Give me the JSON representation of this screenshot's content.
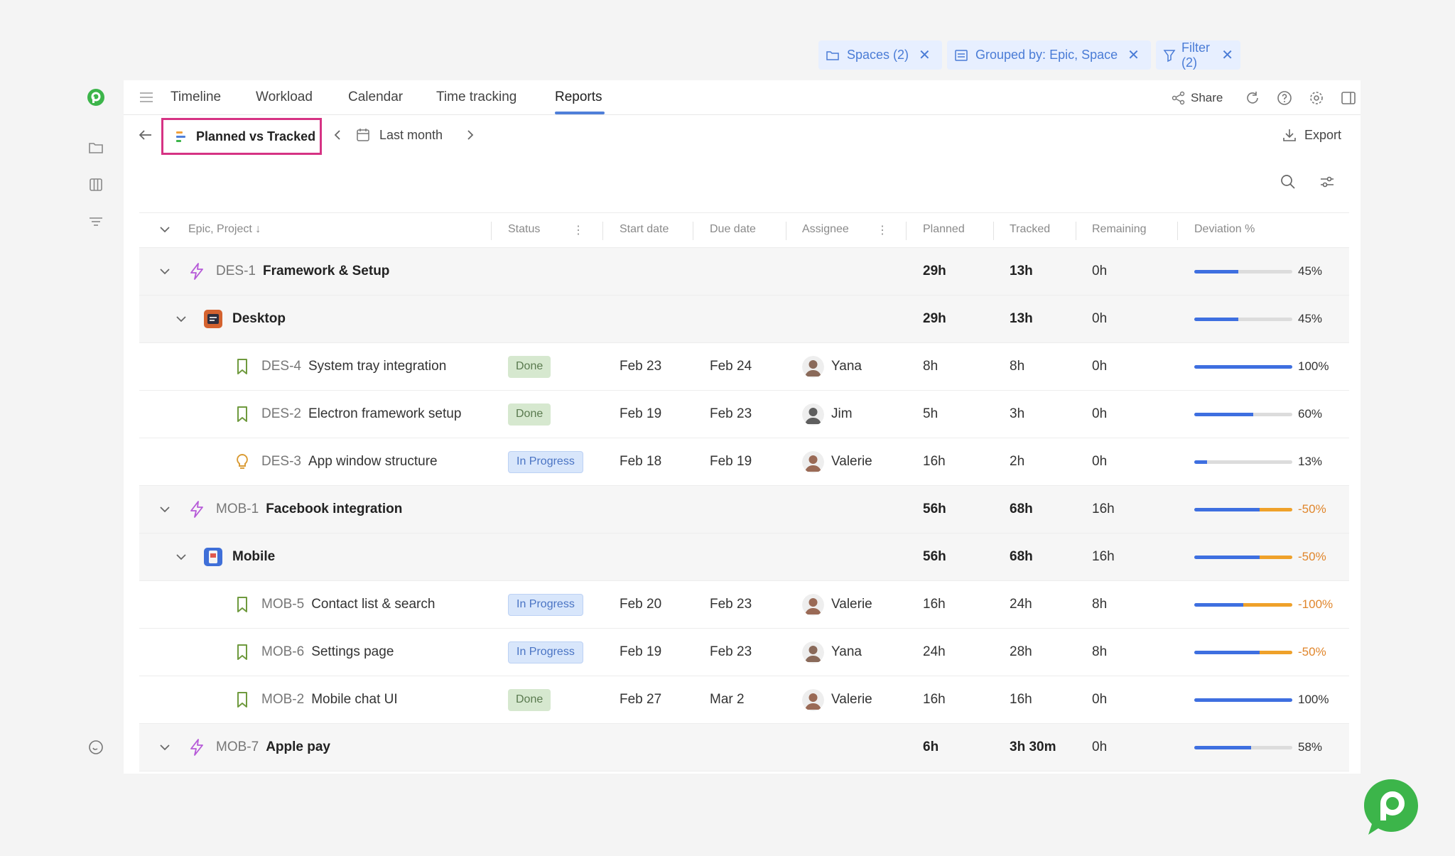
{
  "nav": {
    "tabs": [
      {
        "label": "Timeline"
      },
      {
        "label": "Workload"
      },
      {
        "label": "Calendar"
      },
      {
        "label": "Time tracking"
      },
      {
        "label": "Reports"
      }
    ],
    "active_tab": "Reports",
    "share_label": "Share"
  },
  "toolbar": {
    "report_name": "Planned vs Tracked",
    "period": "Last month",
    "chips": [
      {
        "label": "Spaces (2)",
        "icon": "folder-icon"
      },
      {
        "label": "Grouped by: Epic, Space",
        "icon": "group-icon"
      },
      {
        "label": "Filter (2)",
        "icon": "filter-icon"
      }
    ],
    "export_label": "Export"
  },
  "columns": {
    "name": "Epic, Project",
    "status": "Status",
    "start": "Start date",
    "due": "Due date",
    "assignee": "Assignee",
    "planned": "Planned",
    "tracked": "Tracked",
    "remaining": "Remaining",
    "deviation": "Deviation %"
  },
  "rows": [
    {
      "kind": "epic",
      "key": "DES-1",
      "name": "Framework & Setup",
      "planned": "29h",
      "tracked": "13h",
      "remaining": "0h",
      "progress": 0.45,
      "overrun": 0,
      "deviation": "45%"
    },
    {
      "kind": "project",
      "name": "Desktop",
      "planned": "29h",
      "tracked": "13h",
      "remaining": "0h",
      "progress": 0.45,
      "overrun": 0,
      "deviation": "45%"
    },
    {
      "kind": "task",
      "icon": "bookmark",
      "key": "DES-4",
      "name": "System tray integration",
      "status": "Done",
      "start": "Feb 23",
      "due": "Feb 24",
      "assignee": "Yana",
      "planned": "8h",
      "tracked": "8h",
      "remaining": "0h",
      "progress": 1.0,
      "overrun": 0,
      "deviation": "100%"
    },
    {
      "kind": "task",
      "icon": "bookmark",
      "key": "DES-2",
      "name": "Electron framework setup",
      "status": "Done",
      "start": "Feb 19",
      "due": "Feb 23",
      "assignee": "Jim",
      "planned": "5h",
      "tracked": "3h",
      "remaining": "0h",
      "progress": 0.6,
      "overrun": 0,
      "deviation": "60%"
    },
    {
      "kind": "task",
      "icon": "bulb",
      "key": "DES-3",
      "name": "App window structure",
      "status": "In Progress",
      "start": "Feb 18",
      "due": "Feb 19",
      "assignee": "Valerie",
      "planned": "16h",
      "tracked": "2h",
      "remaining": "0h",
      "progress": 0.13,
      "overrun": 0,
      "deviation": "13%"
    },
    {
      "kind": "epic",
      "key": "MOB-1",
      "name": "Facebook integration",
      "planned": "56h",
      "tracked": "68h",
      "remaining": "16h",
      "progress": 0.67,
      "overrun": 0.33,
      "deviation": "-50%"
    },
    {
      "kind": "project",
      "name": "Mobile",
      "planned": "56h",
      "tracked": "68h",
      "remaining": "16h",
      "progress": 0.67,
      "overrun": 0.33,
      "deviation": "-50%"
    },
    {
      "kind": "task",
      "icon": "bookmark",
      "key": "MOB-5",
      "name": "Contact list & search",
      "status": "In Progress",
      "start": "Feb 20",
      "due": "Feb 23",
      "assignee": "Valerie",
      "planned": "16h",
      "tracked": "24h",
      "remaining": "8h",
      "progress": 0.5,
      "overrun": 0.5,
      "deviation": "-100%"
    },
    {
      "kind": "task",
      "icon": "bookmark",
      "key": "MOB-6",
      "name": "Settings page",
      "status": "In Progress",
      "start": "Feb 19",
      "due": "Feb 23",
      "assignee": "Yana",
      "planned": "24h",
      "tracked": "28h",
      "remaining": "8h",
      "progress": 0.67,
      "overrun": 0.33,
      "deviation": "-50%"
    },
    {
      "kind": "task",
      "icon": "bookmark",
      "key": "MOB-2",
      "name": "Mobile chat UI",
      "status": "Done",
      "start": "Feb 27",
      "due": "Mar 2",
      "assignee": "Valerie",
      "planned": "16h",
      "tracked": "16h",
      "remaining": "0h",
      "progress": 1.0,
      "overrun": 0,
      "deviation": "100%"
    },
    {
      "kind": "epic",
      "key": "MOB-7",
      "name": "Apple pay",
      "planned": "6h",
      "tracked": "3h 30m",
      "remaining": "0h",
      "progress": 0.58,
      "overrun": 0,
      "deviation": "58%"
    }
  ],
  "colors": {
    "brand": "#3cb54a",
    "accent": "#4f7fd9",
    "highlight": "#d63384",
    "overrun": "#efa12a",
    "epic": "#b65ad8"
  }
}
